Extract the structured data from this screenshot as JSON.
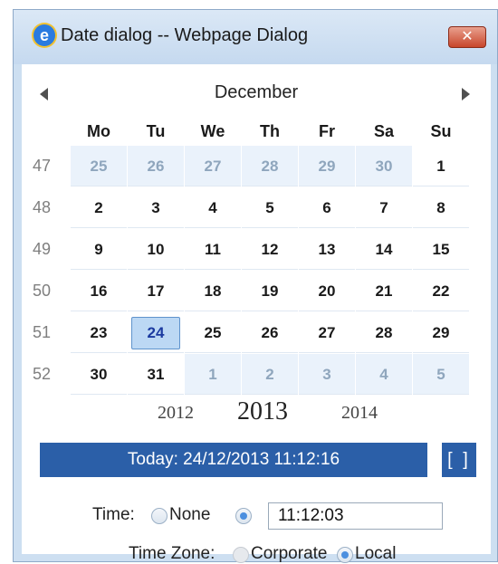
{
  "window": {
    "title": "Date dialog -- Webpage Dialog",
    "close_label": "✕"
  },
  "calendar": {
    "month": "December",
    "weekdays": [
      "Mo",
      "Tu",
      "We",
      "Th",
      "Fr",
      "Sa",
      "Su"
    ],
    "weeks": [
      {
        "num": "47",
        "days": [
          "25",
          "26",
          "27",
          "28",
          "29",
          "30",
          "1"
        ]
      },
      {
        "num": "48",
        "days": [
          "2",
          "3",
          "4",
          "5",
          "6",
          "7",
          "8"
        ]
      },
      {
        "num": "49",
        "days": [
          "9",
          "10",
          "11",
          "12",
          "13",
          "14",
          "15"
        ]
      },
      {
        "num": "50",
        "days": [
          "16",
          "17",
          "18",
          "19",
          "20",
          "21",
          "22"
        ]
      },
      {
        "num": "51",
        "days": [
          "23",
          "24",
          "25",
          "26",
          "27",
          "28",
          "29"
        ]
      },
      {
        "num": "52",
        "days": [
          "30",
          "31",
          "1",
          "2",
          "3",
          "4",
          "5"
        ]
      }
    ],
    "years": [
      "2012",
      "2013",
      "2014"
    ]
  },
  "today_bar": {
    "label": "Today: 24/12/2013 11:12:16",
    "brackets_label": "[ ]"
  },
  "time": {
    "label": "Time:",
    "none_label": "None",
    "value": "11:12:03"
  },
  "timezone": {
    "label": "Time Zone:",
    "corporate_label": "Corporate",
    "local_label": "Local"
  }
}
